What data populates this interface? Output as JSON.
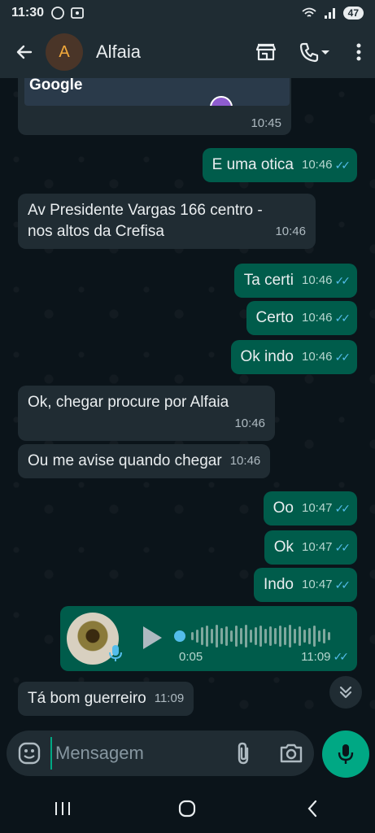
{
  "status_bar": {
    "time": "11:30",
    "battery": "47"
  },
  "header": {
    "avatar_letter": "A",
    "contact_name": "Alfaia"
  },
  "map_message": {
    "map_label": "Google",
    "time": "10:45"
  },
  "messages": [
    {
      "dir": "out",
      "text": "E uma otica",
      "time": "10:46"
    },
    {
      "dir": "in",
      "text": "Av Presidente Vargas 166 centro -",
      "text2": "nos altos da Crefisa",
      "time": "10:46"
    },
    {
      "dir": "out",
      "text": "Ta certi",
      "time": "10:46"
    },
    {
      "dir": "out",
      "text": "Certo",
      "time": "10:46"
    },
    {
      "dir": "out",
      "text": "Ok indo",
      "time": "10:46"
    },
    {
      "dir": "in",
      "text": "Ok, chegar procure por Alfaia",
      "time": "10:46"
    },
    {
      "dir": "in",
      "text": "Ou me avise quando chegar",
      "time": "10:46"
    },
    {
      "dir": "out",
      "text": "Oo",
      "time": "10:47"
    },
    {
      "dir": "out",
      "text": "Ok",
      "time": "10:47"
    },
    {
      "dir": "out",
      "text": "Indo",
      "time": "10:47"
    },
    {
      "dir": "in",
      "text": "Tá bom guerreiro",
      "time": "11:09"
    }
  ],
  "audio_message": {
    "duration": "0:05",
    "time": "11:09"
  },
  "composer": {
    "placeholder": "Mensagem"
  },
  "icons": [
    "back-arrow-icon",
    "store-icon",
    "phone-icon",
    "dropdown-icon",
    "more-icon",
    "emoji-icon",
    "attach-icon",
    "camera-icon",
    "mic-icon",
    "play-icon",
    "chevron-double-down-icon"
  ],
  "colors": {
    "accent": "#00a884",
    "outgoing": "#005c4b",
    "incoming": "#202c33",
    "read_ticks": "#53bdeb"
  }
}
